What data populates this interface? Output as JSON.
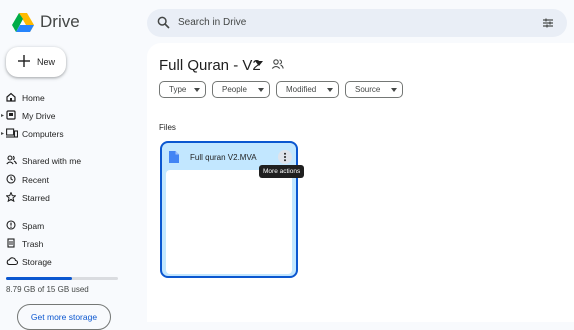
{
  "app": {
    "name": "Drive"
  },
  "search": {
    "placeholder": "Search in Drive"
  },
  "new_button": {
    "label": "New"
  },
  "sidebar": {
    "items": [
      {
        "label": "Home"
      },
      {
        "label": "My Drive"
      },
      {
        "label": "Computers"
      },
      {
        "label": "Shared with me"
      },
      {
        "label": "Recent"
      },
      {
        "label": "Starred"
      },
      {
        "label": "Spam"
      },
      {
        "label": "Trash"
      },
      {
        "label": "Storage"
      }
    ],
    "storage": {
      "used_text": "8.79 GB of 15 GB used",
      "used_fraction": 0.586,
      "button": "Get more storage"
    }
  },
  "main": {
    "folder_title": "Full Quran - V2",
    "filters": [
      {
        "label": "Type"
      },
      {
        "label": "People"
      },
      {
        "label": "Modified"
      },
      {
        "label": "Source"
      }
    ],
    "section_label": "Files",
    "files": [
      {
        "name": "Full quran V2.MVA",
        "icon": "video-file-icon"
      }
    ],
    "tooltip": "More actions"
  },
  "colors": {
    "accent": "#0b57d0",
    "selected_card": "#c2e7ff",
    "background": "#f8fafd"
  }
}
